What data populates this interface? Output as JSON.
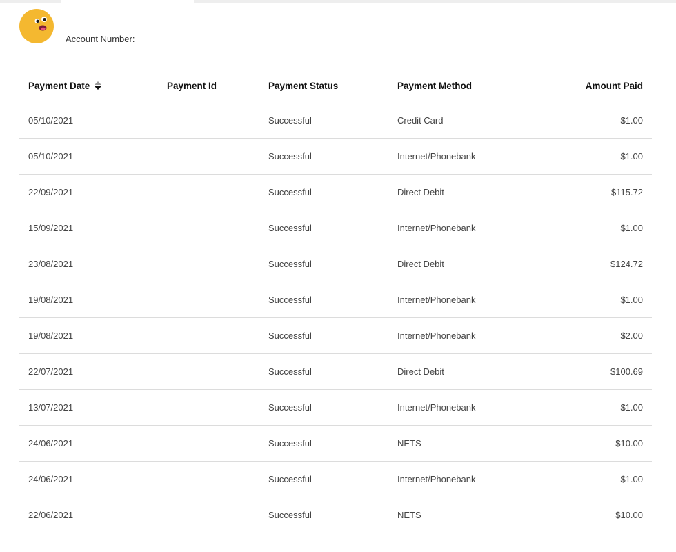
{
  "header": {
    "account_label": "Account Number:",
    "account_value": ""
  },
  "colors": {
    "avatar": "#F4B830",
    "row_divider": "#dcdcdc"
  },
  "table": {
    "columns": [
      "Payment Date",
      "Payment Id",
      "Payment Status",
      "Payment Method",
      "Amount Paid"
    ],
    "rows": [
      {
        "date": "05/10/2021",
        "id": "",
        "status": "Successful",
        "method": "Credit Card",
        "amount": "$1.00"
      },
      {
        "date": "05/10/2021",
        "id": "",
        "status": "Successful",
        "method": "Internet/Phonebank",
        "amount": "$1.00"
      },
      {
        "date": "22/09/2021",
        "id": "",
        "status": "Successful",
        "method": "Direct Debit",
        "amount": "$115.72"
      },
      {
        "date": "15/09/2021",
        "id": "",
        "status": "Successful",
        "method": "Internet/Phonebank",
        "amount": "$1.00"
      },
      {
        "date": "23/08/2021",
        "id": "",
        "status": "Successful",
        "method": "Direct Debit",
        "amount": "$124.72"
      },
      {
        "date": "19/08/2021",
        "id": "",
        "status": "Successful",
        "method": "Internet/Phonebank",
        "amount": "$1.00"
      },
      {
        "date": "19/08/2021",
        "id": "",
        "status": "Successful",
        "method": "Internet/Phonebank",
        "amount": "$2.00"
      },
      {
        "date": "22/07/2021",
        "id": "",
        "status": "Successful",
        "method": "Direct Debit",
        "amount": "$100.69"
      },
      {
        "date": "13/07/2021",
        "id": "",
        "status": "Successful",
        "method": "Internet/Phonebank",
        "amount": "$1.00"
      },
      {
        "date": "24/06/2021",
        "id": "",
        "status": "Successful",
        "method": "NETS",
        "amount": "$10.00"
      },
      {
        "date": "24/06/2021",
        "id": "",
        "status": "Successful",
        "method": "Internet/Phonebank",
        "amount": "$1.00"
      },
      {
        "date": "22/06/2021",
        "id": "",
        "status": "Successful",
        "method": "NETS",
        "amount": "$10.00"
      }
    ]
  }
}
